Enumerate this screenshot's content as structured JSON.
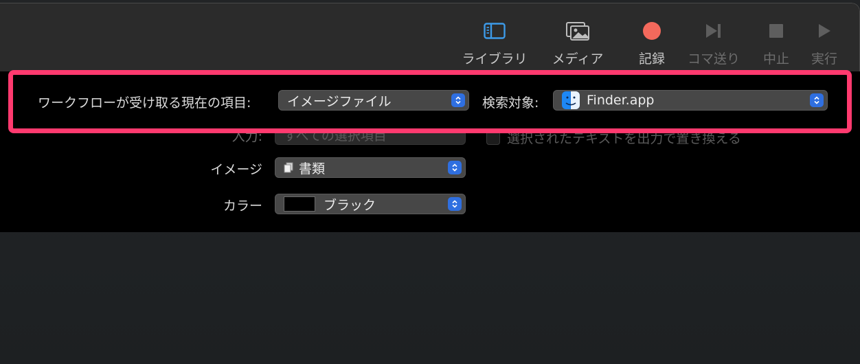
{
  "toolbar": {
    "library": "ライブラリ",
    "media": "メディア",
    "record": "記録",
    "step": "コマ送り",
    "stop": "中止",
    "run": "実行"
  },
  "workflow": {
    "receives_label": "ワークフローが受け取る現在の項目:",
    "receives_value": "イメージファイル",
    "in_label": "検索対象:",
    "in_value": "Finder.app"
  },
  "settings": {
    "input_label": "入力:",
    "input_value": "すべての選択項目",
    "replace_label": "選択されたテキストを出力で置き換える",
    "image_label": "イメージ",
    "image_value": "書類",
    "color_label": "カラー",
    "color_value": "ブラック",
    "color_swatch": "#000000"
  },
  "colors": {
    "highlight": "#ff3a6f",
    "accent": "#2f6fe0",
    "record": "#f4695c"
  }
}
